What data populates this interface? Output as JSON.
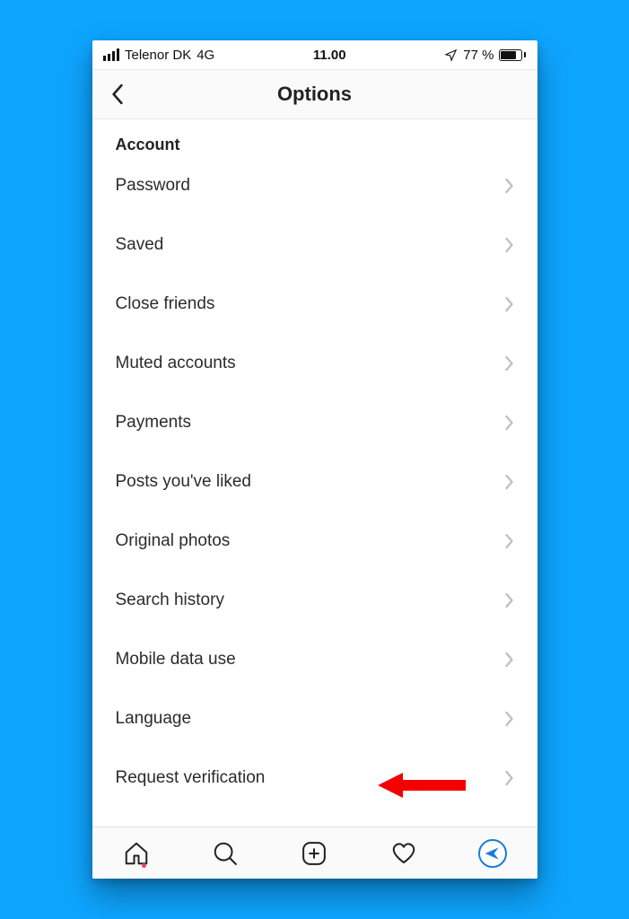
{
  "statusbar": {
    "carrier": "Telenor DK",
    "network": "4G",
    "time": "11.00",
    "battery": "77 %"
  },
  "nav": {
    "title": "Options"
  },
  "section": {
    "title": "Account"
  },
  "items": [
    {
      "label": "Password"
    },
    {
      "label": "Saved"
    },
    {
      "label": "Close friends"
    },
    {
      "label": "Muted accounts"
    },
    {
      "label": "Payments"
    },
    {
      "label": "Posts you've liked"
    },
    {
      "label": "Original photos"
    },
    {
      "label": "Search history"
    },
    {
      "label": "Mobile data use"
    },
    {
      "label": "Language"
    },
    {
      "label": "Request verification"
    }
  ]
}
